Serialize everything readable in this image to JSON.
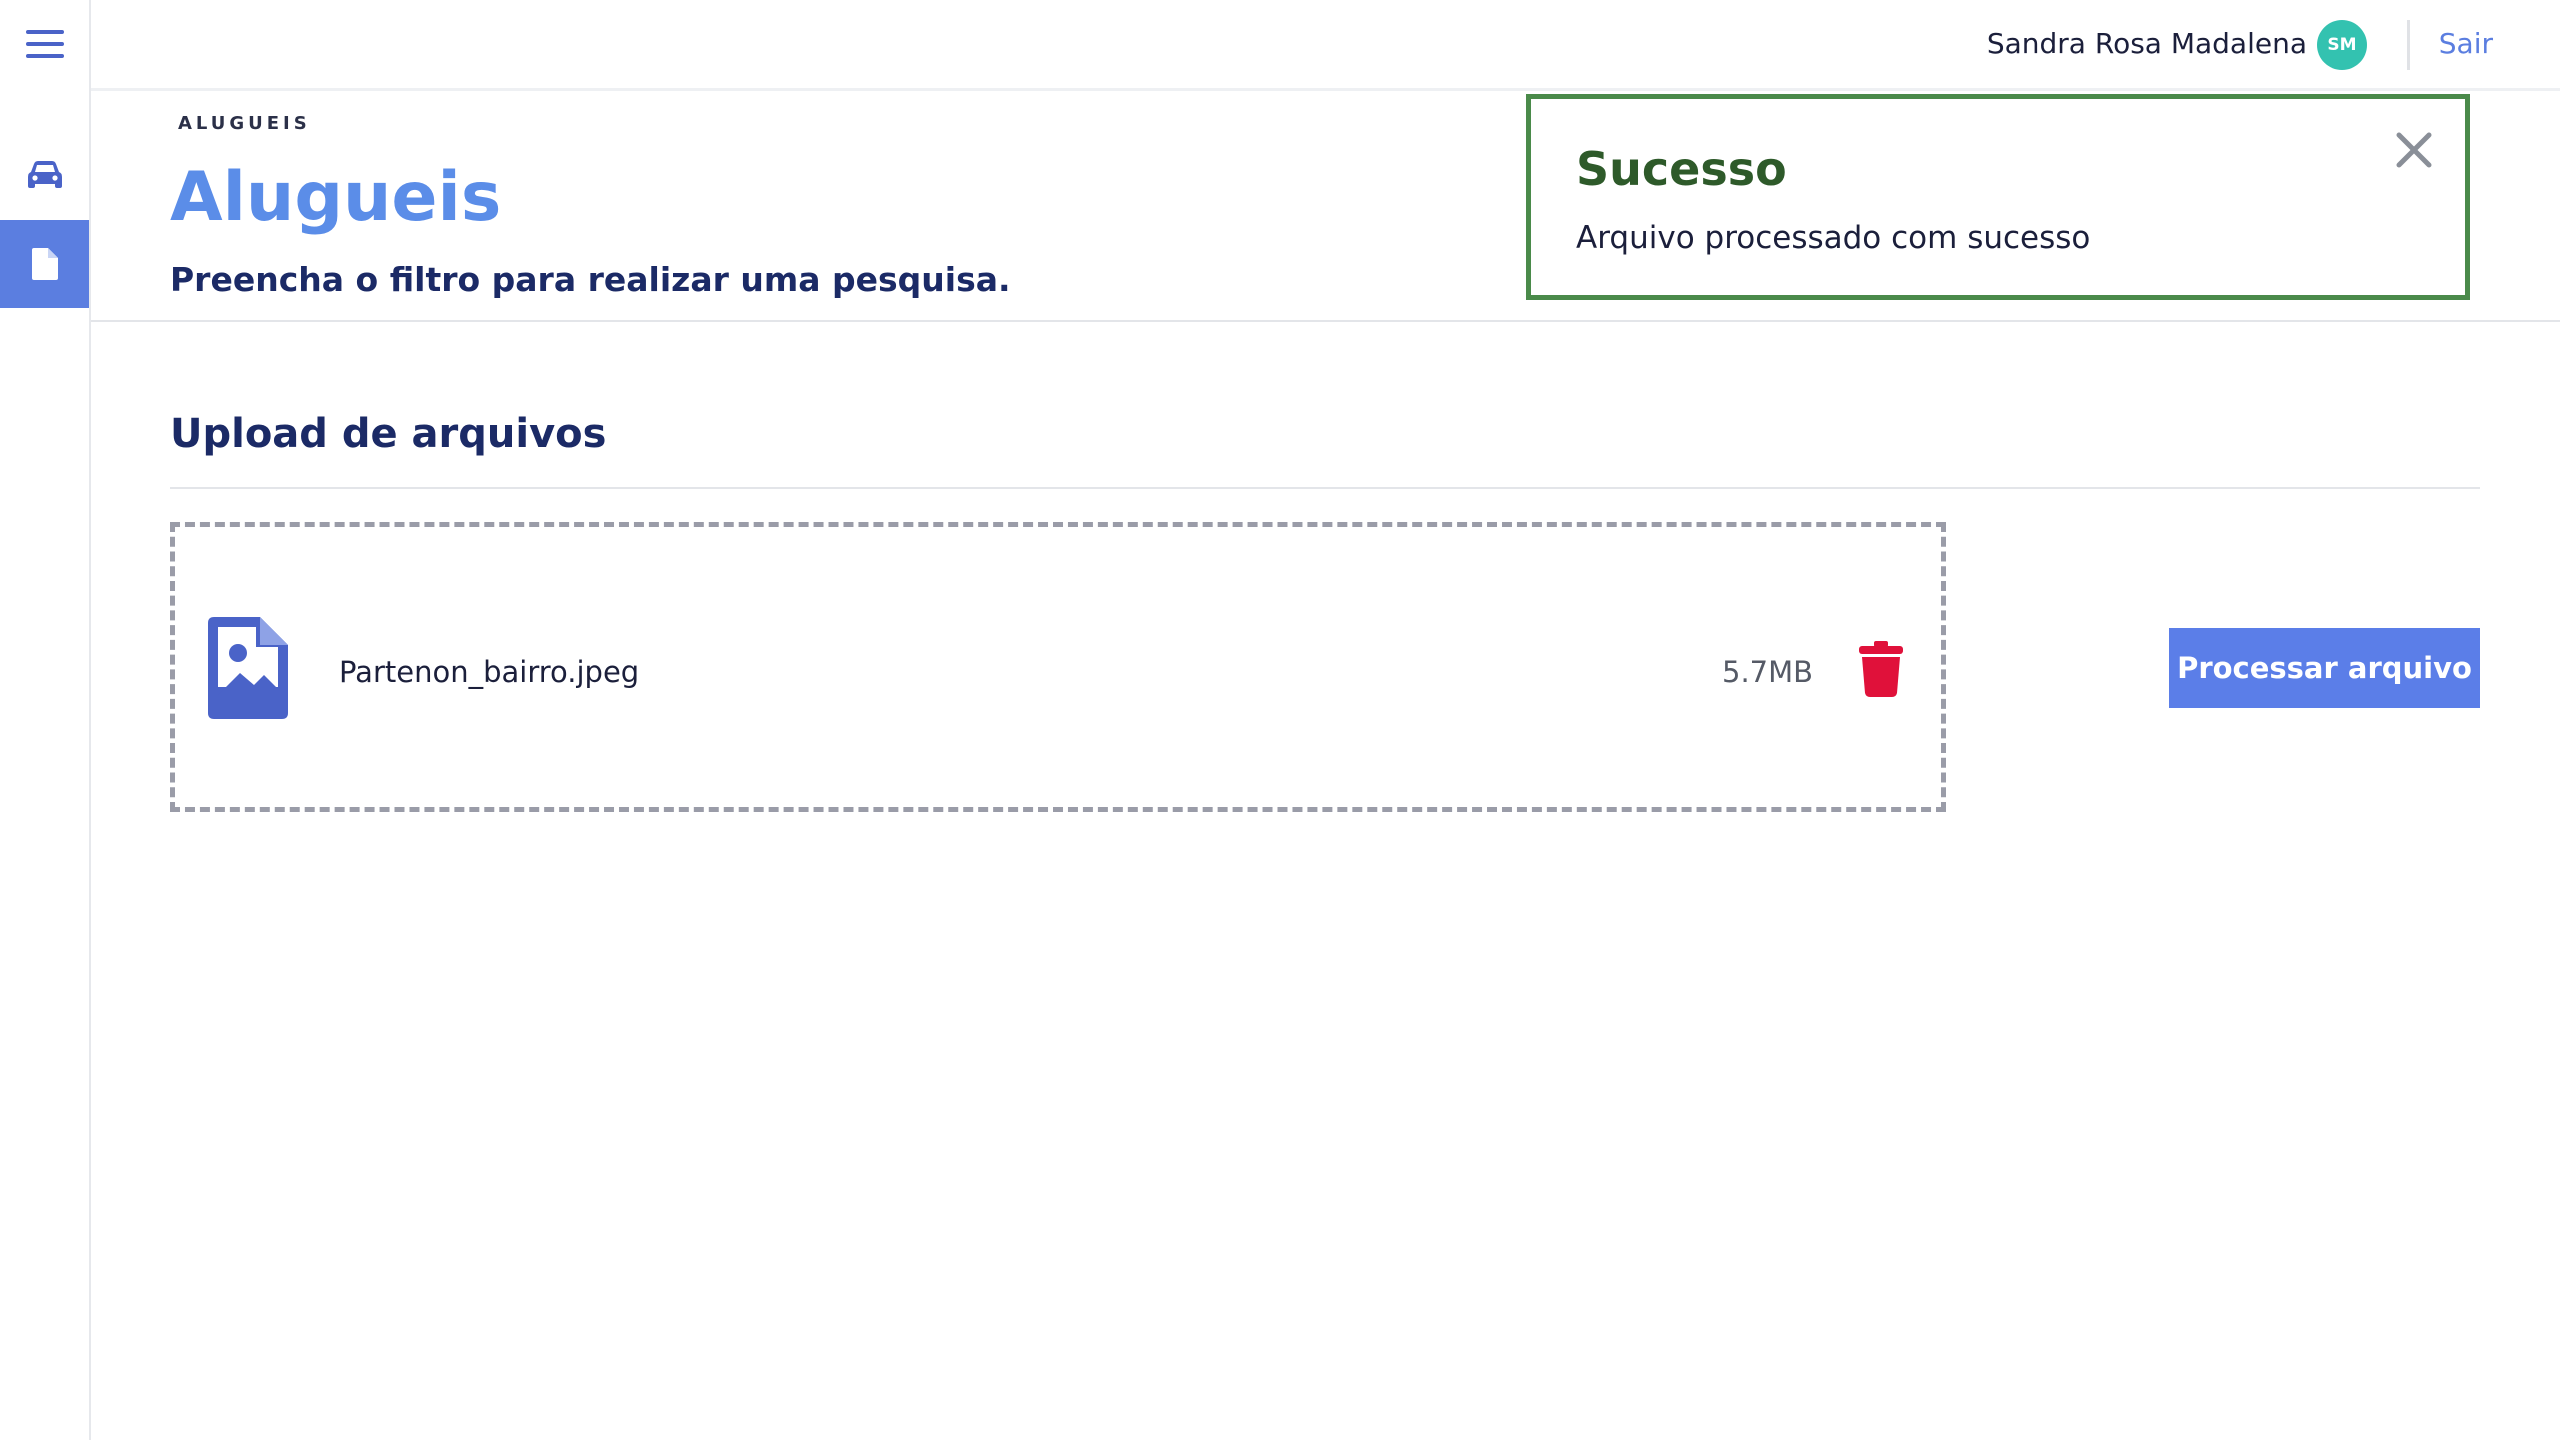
{
  "header": {
    "user_name": "Sandra Rosa Madalena",
    "avatar_initials": "SM",
    "logout_label": "Sair"
  },
  "sidebar": {
    "items": [
      {
        "icon": "menu-icon"
      },
      {
        "icon": "car-icon"
      },
      {
        "icon": "document-icon",
        "active": true
      }
    ]
  },
  "page": {
    "breadcrumb": "ALUGUEIS",
    "title": "Alugueis",
    "subtitle": "Preencha o filtro para realizar uma pesquisa."
  },
  "toast": {
    "title": "Sucesso",
    "message": "Arquivo processado com sucesso",
    "border_color": "#4a8a4a"
  },
  "upload": {
    "section_title": "Upload de arquivos",
    "file": {
      "name": "Partenon_bairro.jpeg",
      "size": "5.7MB",
      "icon": "image-file-icon"
    },
    "process_label": "Processar arquivo"
  },
  "colors": {
    "accent": "#5b7ee0",
    "title": "#5b8de8",
    "navy": "#1b2a66",
    "danger": "#e0113a",
    "avatar": "#33c2b0"
  }
}
